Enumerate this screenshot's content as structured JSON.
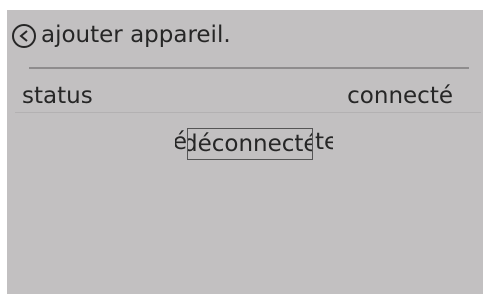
{
  "header": {
    "back_icon": "chevron-left-circle-icon",
    "title": "ajouter appareil."
  },
  "status_row": {
    "label": "status",
    "value": "connecté"
  },
  "picker": {
    "previous_fragment": "dé",
    "selected": "déconnecté",
    "next_fragment": "te"
  },
  "colors": {
    "background": "#c2c0c1",
    "text": "#262626",
    "divider": "#8e8c8d"
  }
}
